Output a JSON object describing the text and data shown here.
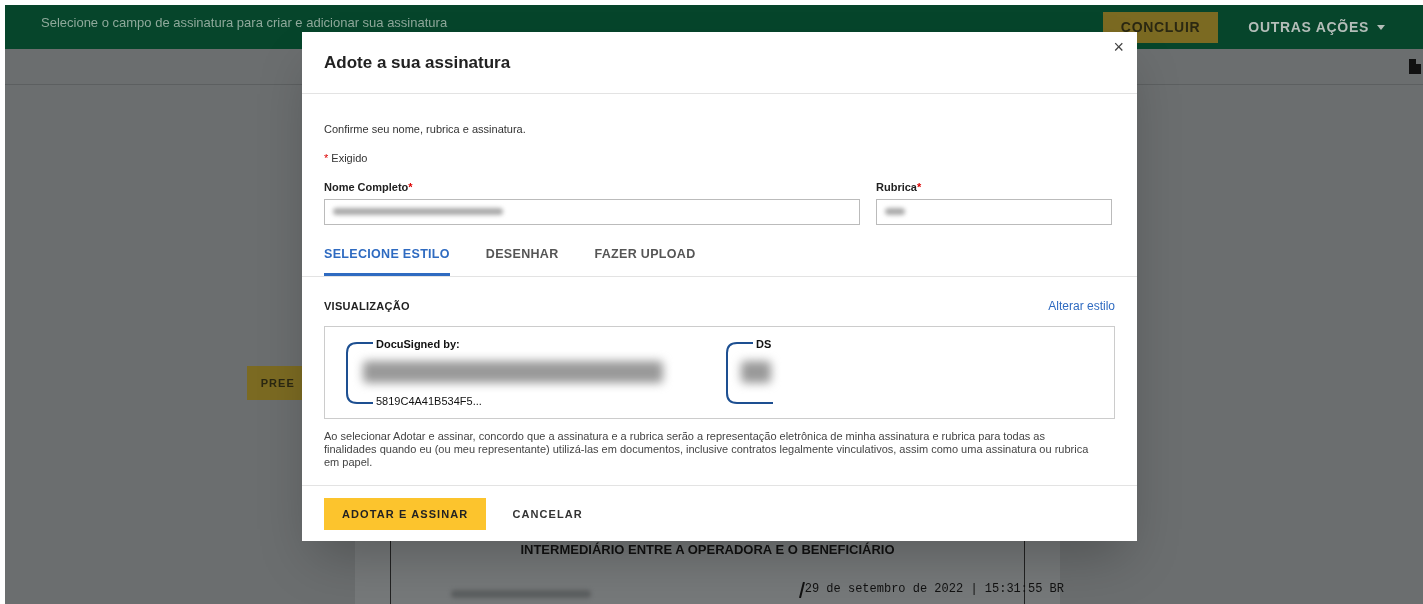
{
  "topbar": {
    "message": "Selecione o campo de assinatura para criar e adicionar sua assinatura",
    "finish_button": "CONCLUIR",
    "more_menu": "OUTRAS AÇÕES"
  },
  "background_button": "PREE",
  "document": {
    "title": "INTERMEDIÁRIO ENTRE A OPERADORA E O BENEFICIÁRIO",
    "timestamp": "29 de setembro de 2022 | 15:31:55 BR"
  },
  "modal": {
    "title": "Adote a sua assinatura",
    "close": "×",
    "intro": "Confirme seu nome, rubrica e assinatura.",
    "required_mark": "*",
    "required_note": "Exigido",
    "fields": [
      {
        "label": "Nome Completo",
        "required": true
      },
      {
        "label": "Rubrica",
        "required": true
      }
    ],
    "tabs": [
      {
        "label": "SELECIONE ESTILO",
        "selected": true
      },
      {
        "label": "DESENHAR",
        "selected": false
      },
      {
        "label": "FAZER UPLOAD",
        "selected": false
      }
    ],
    "preview_label": "VISUALIZAÇÃO",
    "change_style_link": "Alterar estilo",
    "signature": {
      "header": "DocuSigned by:",
      "id": "5819C4A41B534F5..."
    },
    "initials": {
      "header": "DS"
    },
    "disclaimer": "Ao selecionar Adotar e assinar, concordo que a assinatura e a rubrica serão a representação eletrônica de minha assinatura e rubrica para todas as finalidades quando eu (ou meu representante) utilizá-las em documentos, inclusive contratos legalmente vinculativos, assim como uma assinatura ou rubrica em papel.",
    "buttons": [
      {
        "label": "ADOTAR E ASSINAR",
        "kind": "primary"
      },
      {
        "label": "CANCELAR",
        "kind": "secondary"
      }
    ]
  }
}
